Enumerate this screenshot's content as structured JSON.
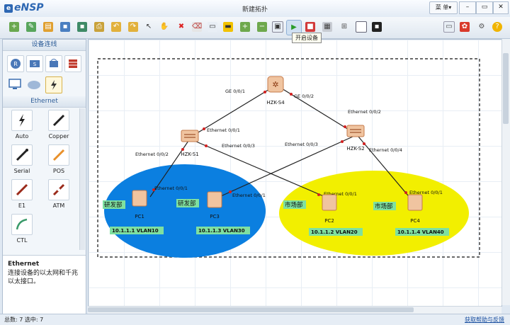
{
  "app": {
    "logo": "eNSP",
    "window_title": "新建拓扑",
    "menu_label": "菜 单▾",
    "controls": {
      "minimize": "–",
      "restore": "▭",
      "close": "✕"
    }
  },
  "toolbar": {
    "tooltip": "开启设备",
    "icons": [
      "new-topology-icon",
      "new-exam-icon",
      "open-icon",
      "save-icon",
      "save-as-icon",
      "print-icon",
      "undo-icon",
      "redo-icon",
      "select-icon",
      "hand-icon",
      "delete-icon",
      "delete-link-icon",
      "text-icon",
      "palette-icon",
      "zoom-in-icon",
      "zoom-out-icon",
      "fit-icon",
      "start-device-icon",
      "stop-device-icon",
      "collect-data-icon",
      "show-interfaces-icon",
      "grid-icon",
      "topology-icon"
    ],
    "right_icons": [
      "chat-icon",
      "huawei-icon",
      "settings-icon",
      "help-icon"
    ]
  },
  "left_panel": {
    "title": "设备连线",
    "device_types": [
      "router-icon",
      "switch-icon",
      "wireless-icon",
      "firewall-icon",
      "pc-icon",
      "cloud-icon",
      "connection-icon"
    ],
    "section_title": "Ethernet",
    "cables": [
      {
        "label": "Auto",
        "icon": "auto-cable-icon"
      },
      {
        "label": "Copper",
        "icon": "copper-cable-icon"
      },
      {
        "label": "Serial",
        "icon": "serial-cable-icon"
      },
      {
        "label": "POS",
        "icon": "pos-cable-icon"
      },
      {
        "label": "E1",
        "icon": "e1-cable-icon"
      },
      {
        "label": "ATM",
        "icon": "atm-cable-icon"
      },
      {
        "label": "CTL",
        "icon": "ctl-cable-icon"
      }
    ],
    "description_title": "Ethernet",
    "description_text": "连接设备的以太网和千兆以太接口。"
  },
  "topology": {
    "areas": [
      {
        "label": "研发部",
        "color": "#0b7fe0"
      },
      {
        "label": "市场部",
        "color": "#f2ef00"
      }
    ],
    "devices": [
      {
        "name": "HZK-S4",
        "type": "router"
      },
      {
        "name": "HZK-S1",
        "type": "switch"
      },
      {
        "name": "HZK-S2",
        "type": "switch"
      },
      {
        "name": "PC1",
        "type": "pc"
      },
      {
        "name": "PC3",
        "type": "pc"
      },
      {
        "name": "PC2",
        "type": "pc"
      },
      {
        "name": "PC4",
        "type": "pc"
      }
    ],
    "area_labels": [
      "研发部",
      "研发部",
      "市场部",
      "市场部"
    ],
    "port_labels": [
      "GE 0/0/1",
      "GE 0/0/2",
      "Ethernet 0/0/1",
      "Ethernet 0/0/2",
      "Ethernet 0/0/3",
      "Ethernet 0/0/2",
      "Ethernet 0/0/3",
      "Ethernet 0/0/4",
      "Ethernet 0/0/1",
      "Ethernet 0/0/1",
      "Ethernet 0/0/1",
      "Ethernet 0/0/1"
    ],
    "addresses": [
      "10.1.1.1 VLAN10",
      "10.1.1.3 VLAN30",
      "10.1.1.2 VLAN20",
      "10.1.1.4 VLAN40"
    ]
  },
  "status": {
    "left": "总数: 7 选中: 7",
    "right": "获取帮助与反馈"
  }
}
